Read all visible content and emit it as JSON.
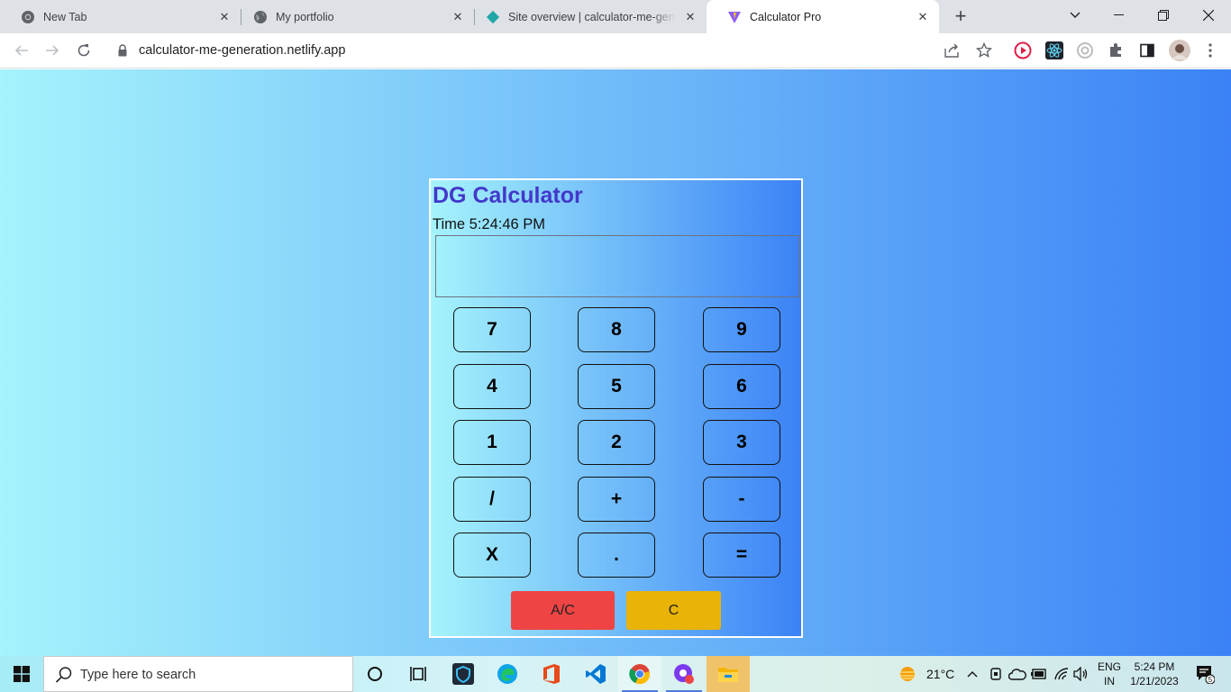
{
  "browser": {
    "tabs": [
      {
        "title": "New Tab",
        "icon": "chrome-icon"
      },
      {
        "title": "My portfolio",
        "icon": "globe-icon"
      },
      {
        "title": "Site overview | calculator-me-generation",
        "icon": "netlify-icon"
      },
      {
        "title": "Calculator Pro",
        "icon": "vite-icon",
        "active": true
      }
    ],
    "url": "calculator-me-generation.netlify.app"
  },
  "calculator": {
    "title": "DG Calculator",
    "time": "Time 5:24:46 PM",
    "display_value": "",
    "keys": [
      "7",
      "8",
      "9",
      "4",
      "5",
      "6",
      "1",
      "2",
      "3",
      "/",
      "+",
      "-",
      "X",
      ".",
      "="
    ],
    "clear_all_label": "A/C",
    "clear_label": "C",
    "colors": {
      "title": "#4338ca",
      "gradient_start": "#a5f3fc",
      "gradient_end": "#3b82f6",
      "clear_all": "#ef4444",
      "clear": "#eab308"
    }
  },
  "taskbar": {
    "search_placeholder": "Type here to search",
    "weather": "21°C",
    "language_line1": "ENG",
    "language_line2": "IN",
    "time": "5:24 PM",
    "date": "1/21/2023",
    "notification_count": "5"
  }
}
